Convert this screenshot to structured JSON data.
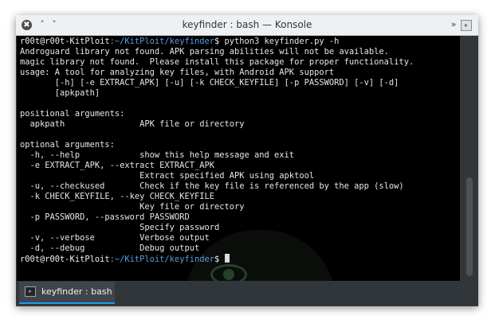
{
  "window": {
    "title": "keyfinder : bash — Konsole",
    "close_icon": "✖",
    "minimize_icon": "˄",
    "maximize_icon": "˅",
    "keep_above_icon": "»",
    "menu_icon": "▸"
  },
  "prompt": {
    "user": "r00t@r00t-KitPloit",
    "path": ":~/KitPloit/keyfinder",
    "symbol": "$"
  },
  "terminal_lines": [
    {
      "type": "prompt",
      "command": " python3 keyfinder.py -h"
    },
    {
      "type": "text",
      "text": "Androguard library not found. APK parsing abilities will not be available."
    },
    {
      "type": "text",
      "text": "magic library not found.  Please install this package for proper functionality."
    },
    {
      "type": "text",
      "text": "usage: A tool for analyzing key files, with Android APK support"
    },
    {
      "type": "text",
      "text": "       [-h] [-e EXTRACT_APK] [-u] [-k CHECK_KEYFILE] [-p PASSWORD] [-v] [-d]"
    },
    {
      "type": "text",
      "text": "       [apkpath]"
    },
    {
      "type": "text",
      "text": ""
    },
    {
      "type": "text",
      "text": "positional arguments:"
    },
    {
      "type": "text",
      "text": "  apkpath               APK file or directory"
    },
    {
      "type": "text",
      "text": ""
    },
    {
      "type": "text",
      "text": "optional arguments:"
    },
    {
      "type": "text",
      "text": "  -h, --help            show this help message and exit"
    },
    {
      "type": "text",
      "text": "  -e EXTRACT_APK, --extract EXTRACT_APK"
    },
    {
      "type": "text",
      "text": "                        Extract specified APK using apktool"
    },
    {
      "type": "text",
      "text": "  -u, --checkused       Check if the key file is referenced by the app (slow)"
    },
    {
      "type": "text",
      "text": "  -k CHECK_KEYFILE, --key CHECK_KEYFILE"
    },
    {
      "type": "text",
      "text": "                        Key file or directory"
    },
    {
      "type": "text",
      "text": "  -p PASSWORD, --password PASSWORD"
    },
    {
      "type": "text",
      "text": "                        Specify password"
    },
    {
      "type": "text",
      "text": "  -v, --verbose         Verbose output"
    },
    {
      "type": "text",
      "text": "  -d, --debug           Debug output"
    },
    {
      "type": "prompt",
      "command": " ",
      "cursor": true
    }
  ],
  "tabs": [
    {
      "label": "keyfinder : bash",
      "icon": "▸",
      "active": true
    }
  ],
  "colors": {
    "prompt_path": "#5a9ce0",
    "terminal_bg": "#000000",
    "terminal_text": "#e6e6e6",
    "chrome": "#31363b",
    "tab_accent": "#1d99f3"
  }
}
